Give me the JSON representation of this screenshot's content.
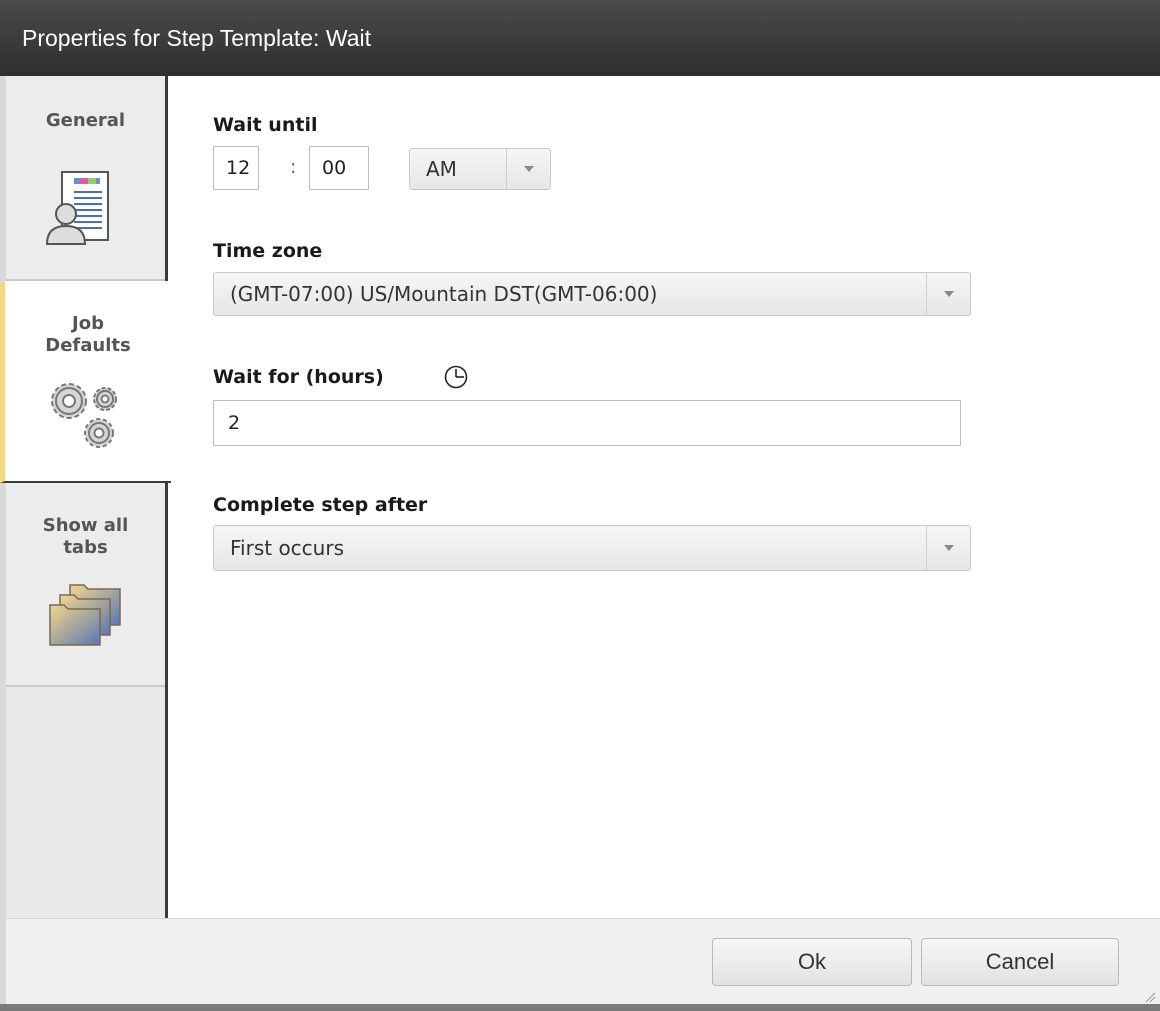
{
  "window": {
    "title": "Properties for Step Template: Wait"
  },
  "sidebar": {
    "tabs": [
      {
        "label": "General",
        "icon": "user-document-icon"
      },
      {
        "label": "Job Defaults",
        "icon": "gears-icon",
        "selected": true
      },
      {
        "label": "Show all tabs",
        "icon": "folders-icon"
      }
    ]
  },
  "form": {
    "wait_until": {
      "label": "Wait until",
      "hour": "12",
      "separator": ":",
      "minute": "00",
      "ampm": "AM"
    },
    "time_zone": {
      "label": "Time zone",
      "value": "(GMT-07:00) US/Mountain DST(GMT-06:00)"
    },
    "wait_for": {
      "label": "Wait for (hours)",
      "icon": "clock-icon",
      "value": "2"
    },
    "complete_after": {
      "label": "Complete step after",
      "value": "First occurs"
    }
  },
  "footer": {
    "ok_label": "Ok",
    "cancel_label": "Cancel"
  },
  "colors": {
    "titlebar": "#3b3b3b",
    "selected_tab_accent": "#f1d98a"
  }
}
